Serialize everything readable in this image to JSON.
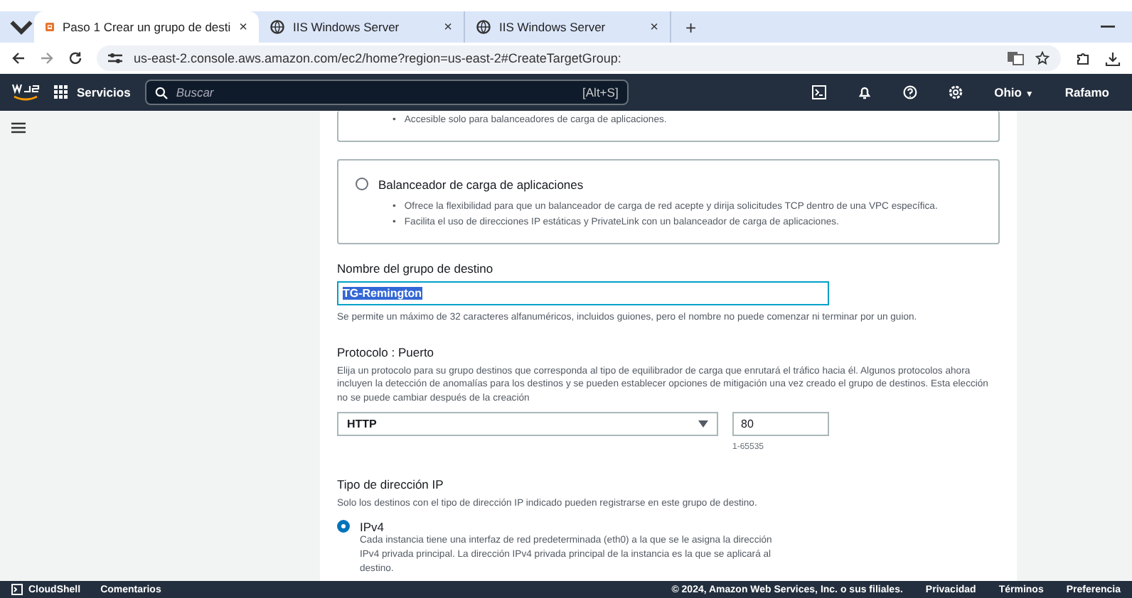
{
  "browser": {
    "tabs": [
      {
        "kind": "aws",
        "title": "Paso 1 Crear un grupo de desti",
        "close": "×",
        "selected": true
      },
      {
        "kind": "globe",
        "title": "IIS Windows Server",
        "close": "×",
        "selected": false
      },
      {
        "kind": "globe",
        "title": "IIS Windows Server",
        "close": "×",
        "selected": false
      }
    ],
    "new_tab": "+",
    "url": "us-east-2.console.aws.amazon.com/ec2/home?region=us-east-2#CreateTargetGroup:"
  },
  "navbar": {
    "services": "Servicios",
    "search": {
      "placeholder": "Buscar",
      "shortcut": "[Alt+S]"
    },
    "region": "Ohio",
    "region_caret": "▼",
    "account": "Rafamo"
  },
  "previous_option": {
    "marker": "•",
    "bullets": [
      "Accesible solo para balanceadores de carga de aplicaciones."
    ]
  },
  "lb_option": {
    "label": "Balanceador de carga de aplicaciones",
    "selected": false,
    "marker": "•",
    "bullets": [
      "Ofrece la flexibilidad para que un balanceador de carga de red acepte y dirija solicitudes TCP dentro de una VPC específica.",
      "Facilita el uso de direcciones IP estáticas y PrivateLink con un balanceador de carga de aplicaciones."
    ]
  },
  "target_group_name": {
    "label": "Nombre del grupo de destino",
    "value": "TG-Remington",
    "hint": "Se permite un máximo de 32 caracteres alfanuméricos, incluidos guiones, pero el nombre no puede comenzar ni terminar por un guion."
  },
  "protocol_port": {
    "label": "Protocolo : Puerto",
    "description": "Elija un protocolo para su grupo destinos que corresponda al tipo de equilibrador de carga que enrutará el tráfico hacia él. Algunos protocolos ahora incluyen la detección de anomalías para los destinos y se pueden establecer opciones de mitigación una vez creado el grupo de destinos. Esta elección no se puede cambiar después de la creación",
    "protocol": "HTTP",
    "port": "80",
    "port_hint": "1-65535"
  },
  "ip_type": {
    "label": "Tipo de dirección IP",
    "description": "Solo los destinos con el tipo de dirección IP indicado pueden registrarse en este grupo de destino.",
    "options": [
      {
        "label": "IPv4",
        "selected": true,
        "description": "Cada instancia tiene una interfaz de red predeterminada (eth0) a la que se le asigna la dirección IPv4 privada principal. La dirección IPv4 privada principal de la instancia es la que se aplicará al destino."
      }
    ]
  },
  "footer": {
    "left": [
      "CloudShell",
      "Comentarios"
    ],
    "copyright": "© 2024, Amazon Web Services, Inc. o sus filiales.",
    "links": [
      "Privacidad",
      "Términos",
      "Preferencia"
    ]
  }
}
